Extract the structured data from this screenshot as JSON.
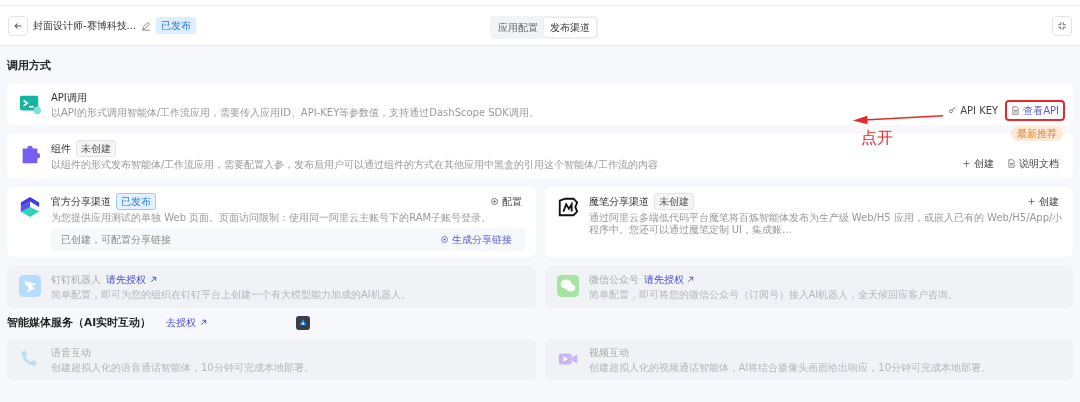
{
  "header": {
    "title": "封面设计师-赛博科技...",
    "status": "已发布",
    "tabs": [
      {
        "label": "应用配置",
        "selected": false
      },
      {
        "label": "发布渠道",
        "selected": true
      }
    ]
  },
  "sections": [
    {
      "title": "调用方式",
      "items": [
        {
          "kind": "api",
          "title": "API调用",
          "description": "以API的形式调用智能体/工作流应用，需要传入应用ID、API-KEY等参数值，支持通过DashScope SDK调用。",
          "disabled": false,
          "actions": [
            {
              "kind": "key",
              "label": "API KEY",
              "highlighted": false
            },
            {
              "kind": "doc",
              "label": "查看API",
              "highlighted": true
            }
          ],
          "annotation": "点开"
        },
        {
          "kind": "component",
          "title": "组件",
          "badge": {
            "kind": "draft",
            "text": "未创建"
          },
          "promo": "最新推荐",
          "description": "以组件的形式发布智能体/工作流应用，需要配置入参，发布后用户可以通过组件的方式在其他应用中黑盒的引用这个智能体/工作流的内容",
          "disabled": false,
          "actions": [
            {
              "kind": "plus",
              "label": "创建",
              "highlighted": false
            },
            {
              "kind": "doc",
              "label": "说明文档",
              "highlighted": false
            }
          ]
        },
        {
          "kind": "share",
          "title": "官方分享渠道",
          "badge": {
            "kind": "published",
            "text": "已发布"
          },
          "description": "为您提供应用测试的单独 Web 页面。页面访问限制：使用同一阿里云主账号下的RAM子账号登录。",
          "disabled": false,
          "actions": [
            {
              "kind": "gear",
              "label": "配置",
              "highlighted": false
            }
          ],
          "footer": {
            "text": "已创建，可配置分享链接",
            "action": "生成分享链接"
          }
        },
        {
          "kind": "mobi",
          "title": "魔笔分享渠道",
          "badge": {
            "kind": "draft",
            "text": "未创建"
          },
          "description": "通过阿里云多端低代码平台魔笔将百炼智能体发布为生产级 Web/H5 应用，或嵌入已有的 Web/H5/App/小程序中。您还可以通过魔笔定制 UI，集成账…",
          "disabled": false,
          "actions": [
            {
              "kind": "plus",
              "label": "创建",
              "highlighted": false
            }
          ]
        },
        {
          "kind": "dingtalk",
          "title": "钉钉机器人",
          "auth_link": "请先授权",
          "description": "简单配置，即可为您的组织在钉钉平台上创建一个有大模型能力加成的AI机器人。",
          "disabled": true
        },
        {
          "kind": "wechat",
          "title": "微信公众号",
          "auth_link": "请先授权",
          "description": "简单配置，即可将您的微信公众号（订阅号）接入AI机器人，全天候回应客户咨询。",
          "disabled": true
        }
      ]
    },
    {
      "title": "智能媒体服务（AI实时互动）",
      "auth_link": "去授权",
      "items": [
        {
          "kind": "voice",
          "title": "语音互动",
          "description": "创建超拟人化的语音通话智能体，10分钟可完成本地部署。",
          "disabled": true
        },
        {
          "kind": "video",
          "title": "视频互动",
          "description": "创建超拟人化的视频通话智能体，AI将结合摄像头画面给出响应，10分钟可完成本地部署。",
          "disabled": true
        }
      ]
    }
  ]
}
